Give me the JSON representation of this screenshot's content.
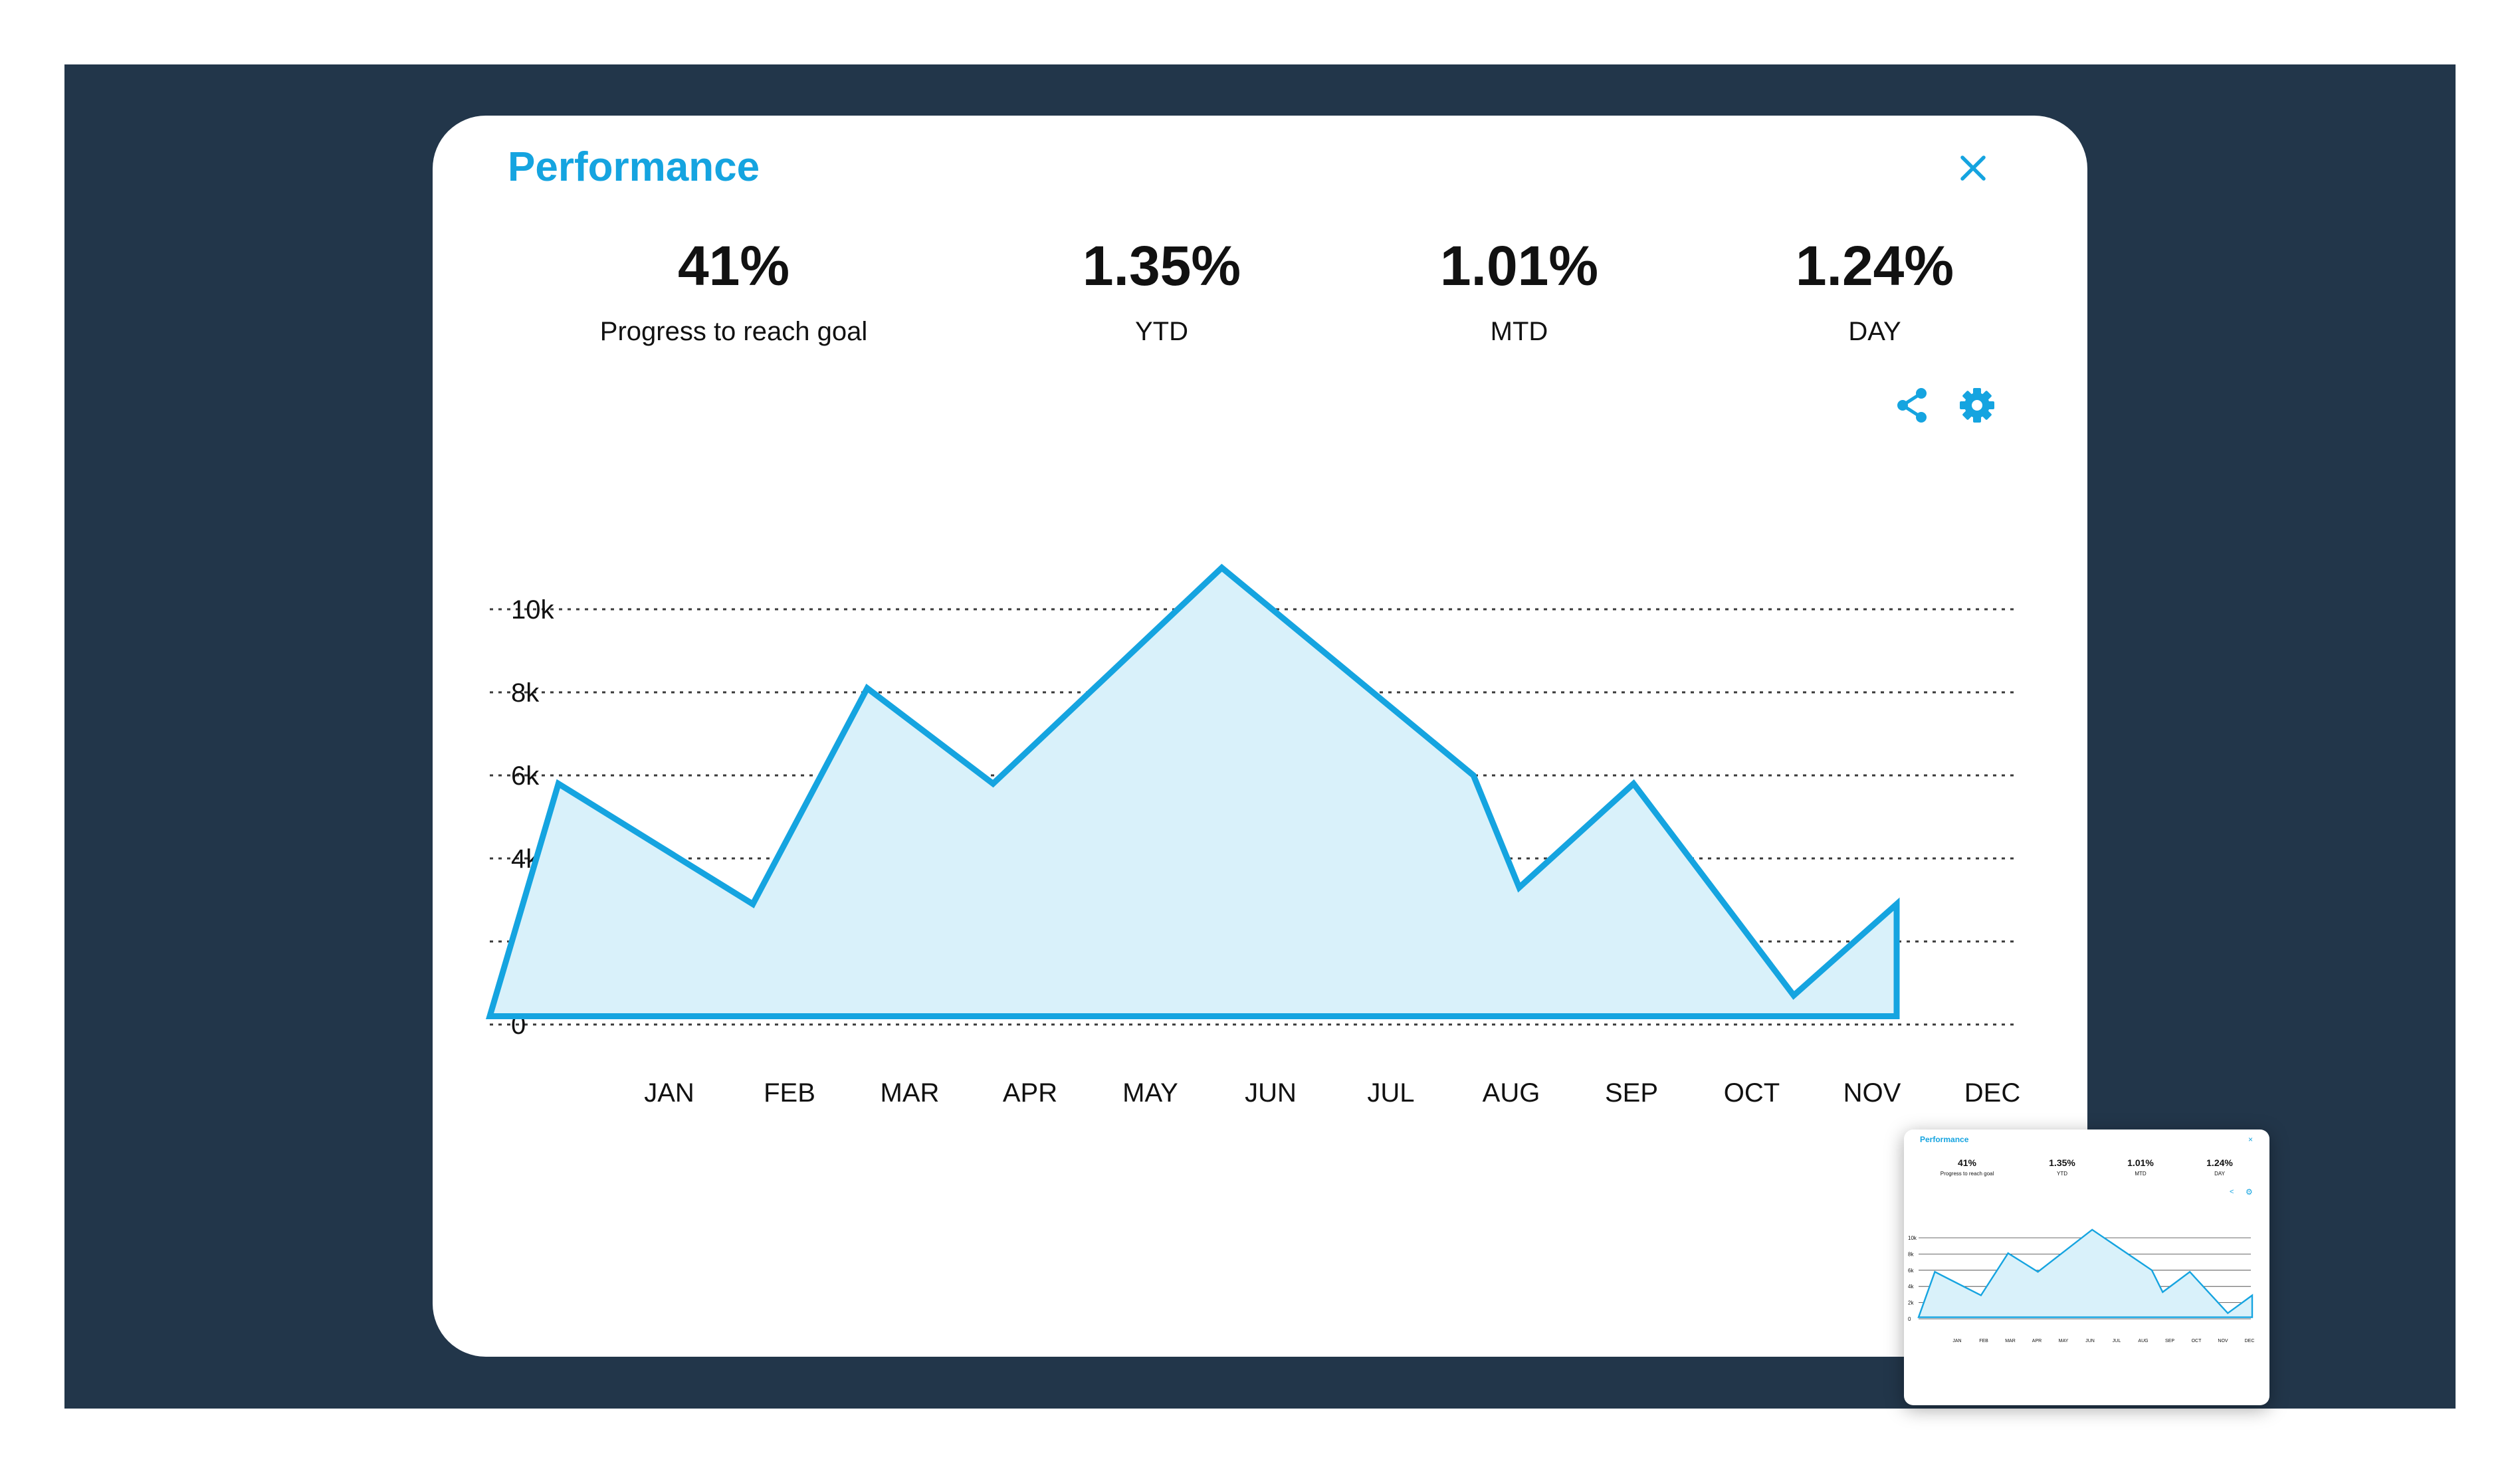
{
  "panel": {
    "title": "Performance",
    "close_icon": "close-icon",
    "share_icon": "share-icon",
    "settings_icon": "gear-icon"
  },
  "stats": [
    {
      "value": "41%",
      "label": "Progress to reach goal"
    },
    {
      "value": "1.35%",
      "label": "YTD"
    },
    {
      "value": "1.01%",
      "label": "MTD"
    },
    {
      "value": "1.24%",
      "label": "DAY"
    }
  ],
  "colors": {
    "accent": "#15a4e0",
    "area_fill": "#d9f1fa",
    "backdrop": "#22364a",
    "text": "#111111"
  },
  "chart_data": {
    "type": "area",
    "categories": [
      "JAN",
      "FEB",
      "MAR",
      "APR",
      "MAY",
      "JUN",
      "JUL",
      "AUG",
      "SEP",
      "OCT",
      "NOV",
      "DEC"
    ],
    "y_ticks": [
      {
        "value": 0,
        "label": "0"
      },
      {
        "value": 2000,
        "label": "2k"
      },
      {
        "value": 4000,
        "label": "4k"
      },
      {
        "value": 6000,
        "label": "6k"
      },
      {
        "value": 8000,
        "label": "8k"
      },
      {
        "value": 10000,
        "label": "10k"
      }
    ],
    "ylim": [
      0,
      10000
    ],
    "points": [
      {
        "x": 0.0,
        "y": 200
      },
      {
        "x": 0.6,
        "y": 5800
      },
      {
        "x": 2.3,
        "y": 2900
      },
      {
        "x": 3.3,
        "y": 8100
      },
      {
        "x": 4.4,
        "y": 5800
      },
      {
        "x": 6.4,
        "y": 11000
      },
      {
        "x": 8.6,
        "y": 6000
      },
      {
        "x": 9.0,
        "y": 3300
      },
      {
        "x": 10.0,
        "y": 5800
      },
      {
        "x": 11.4,
        "y": 700
      },
      {
        "x": 12.3,
        "y": 2900
      },
      {
        "x": 12.3,
        "y": 200
      }
    ],
    "x_range": [
      0,
      12.3
    ],
    "grid": true,
    "legend": false
  },
  "thumbnail": {
    "title": "Performance",
    "close_glyph": "×",
    "share_glyph": "<",
    "gear_glyph": "⚙"
  }
}
